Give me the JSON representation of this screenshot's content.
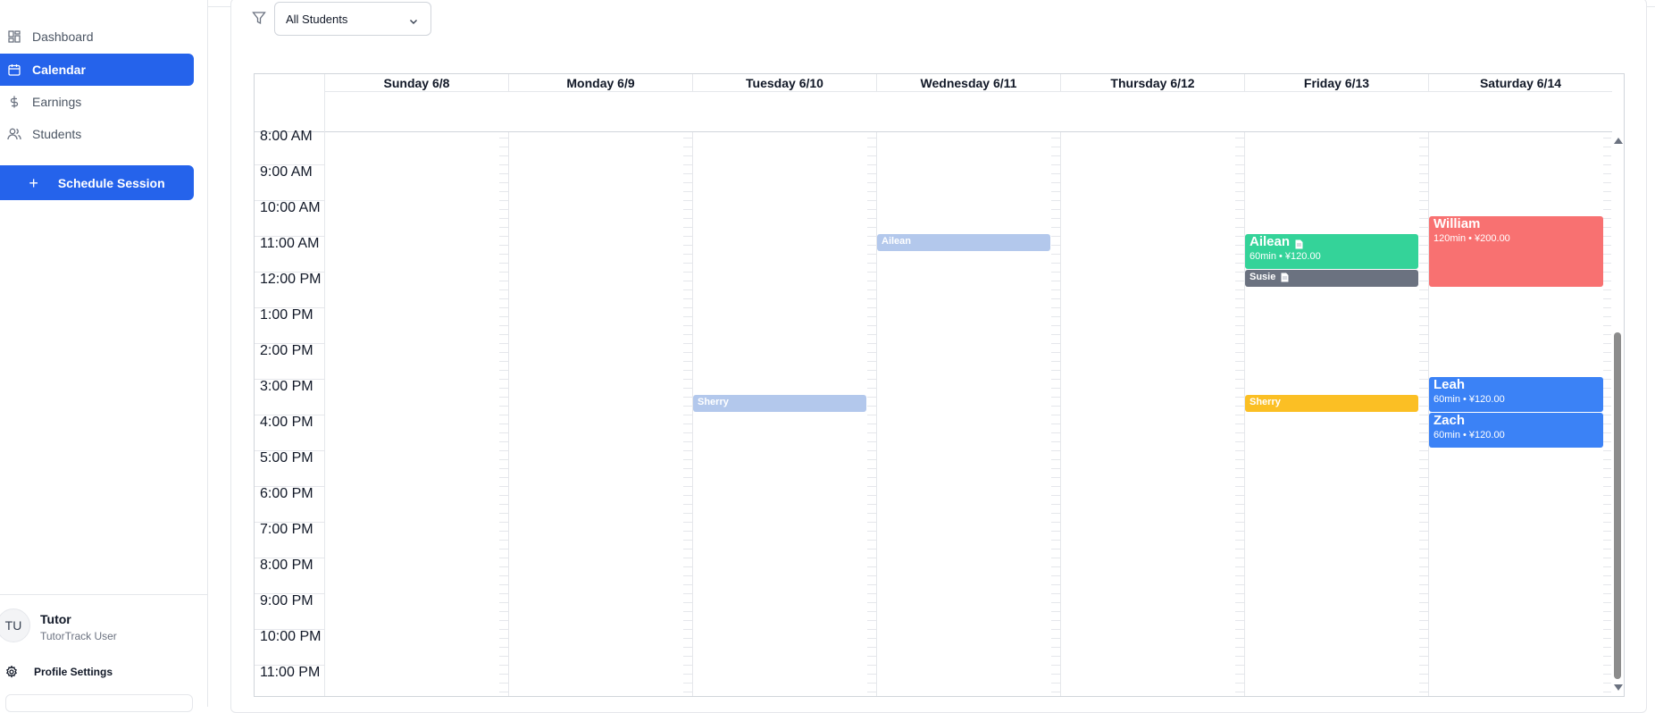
{
  "sidebar": {
    "nav": [
      {
        "label": "Dashboard",
        "icon": "dashboard-grid-icon"
      },
      {
        "label": "Calendar",
        "icon": "calendar-icon",
        "active": true
      },
      {
        "label": "Earnings",
        "icon": "dollar-icon"
      },
      {
        "label": "Students",
        "icon": "users-icon"
      }
    ],
    "schedule_button": "Schedule Session",
    "user": {
      "initials": "TU",
      "name": "Tutor",
      "role": "TutorTrack User"
    },
    "profile_settings": "Profile Settings"
  },
  "filter": {
    "selected": "All Students",
    "icon": "filter-icon"
  },
  "calendar": {
    "days": [
      "Sunday 6/8",
      "Monday 6/9",
      "Tuesday 6/10",
      "Wednesday 6/11",
      "Thursday 6/12",
      "Friday 6/13",
      "Saturday 6/14"
    ],
    "times": [
      "8:00 AM",
      "9:00 AM",
      "10:00 AM",
      "11:00 AM",
      "12:00 PM",
      "1:00 PM",
      "2:00 PM",
      "3:00 PM",
      "4:00 PM",
      "5:00 PM",
      "6:00 PM",
      "7:00 PM",
      "8:00 PM",
      "9:00 PM",
      "10:00 PM",
      "11:00 PM"
    ],
    "events": [
      {
        "student": "Ailean",
        "day": "Wednesday 6/11",
        "start": "11:00 AM",
        "color": "#b3c8ec",
        "detail": "",
        "note_icon": false
      },
      {
        "student": "Sherry",
        "day": "Tuesday 6/10",
        "start": "3:30 PM",
        "color": "#b3c8ec",
        "detail": "",
        "note_icon": false
      },
      {
        "student": "Ailean",
        "day": "Friday 6/13",
        "start": "11:00 AM",
        "color": "#34d399",
        "detail": "60min • ¥120.00",
        "note_icon": true
      },
      {
        "student": "Susie",
        "day": "Friday 6/13",
        "start": "12:00 PM",
        "color": "#6b7280",
        "detail": "",
        "note_icon": true
      },
      {
        "student": "Sherry",
        "day": "Friday 6/13",
        "start": "3:30 PM",
        "color": "#fbbf24",
        "detail": "",
        "note_icon": false
      },
      {
        "student": "William",
        "day": "Saturday 6/14",
        "start": "10:30 AM",
        "color": "#f87171",
        "detail": "120min • ¥200.00",
        "note_icon": false
      },
      {
        "student": "Leah",
        "day": "Saturday 6/14",
        "start": "3:00 PM",
        "color": "#3b82f6",
        "detail": "60min • ¥120.00",
        "note_icon": false
      },
      {
        "student": "Zach",
        "day": "Saturday 6/14",
        "start": "4:00 PM",
        "color": "#3b82f6",
        "detail": "60min • ¥120.00",
        "note_icon": false
      }
    ]
  },
  "colors": {
    "accent": "#2563eb"
  }
}
